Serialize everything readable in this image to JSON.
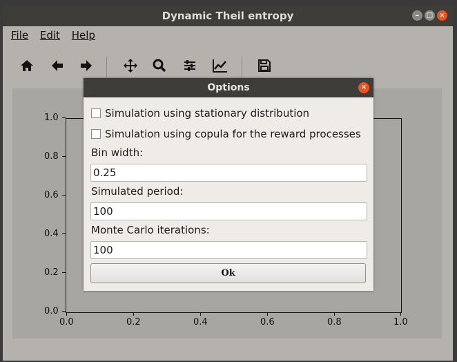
{
  "window": {
    "title": "Dynamic Theil entropy"
  },
  "menu": {
    "items": [
      "File",
      "Edit",
      "Help"
    ]
  },
  "toolbar": {
    "home": "🏠",
    "back": "←",
    "forward": "→",
    "pan": "✥",
    "zoom": "🔍",
    "configure": "☰",
    "edit": "📈",
    "save": "💾"
  },
  "plot": {
    "yticks": [
      "1.0",
      "0.8",
      "0.6",
      "0.4",
      "0.2",
      "0.0"
    ],
    "xticks": [
      "0.0",
      "0.2",
      "0.4",
      "0.6",
      "0.8",
      "1.0"
    ]
  },
  "dialog": {
    "title": "Options",
    "check1": "Simulation using stationary distribution",
    "check2": "Simulation using copula for the reward processes",
    "bin_label": "Bin width:",
    "bin_value": "0.25",
    "period_label": "Simulated period:",
    "period_value": "100",
    "mc_label": "Monte Carlo iterations:",
    "mc_value": "100",
    "ok_label": "Ok"
  },
  "colors": {
    "titlebar": "#3e3d39",
    "close": "#e9541f",
    "dialog_bg": "#efebe7"
  }
}
